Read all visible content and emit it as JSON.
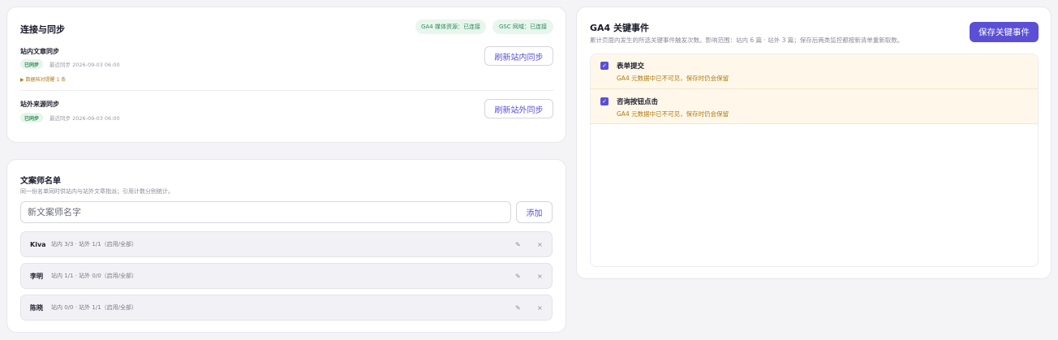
{
  "sync": {
    "title": "连接与同步",
    "ga4_status": "GA4 媒体资源：已连接",
    "gsc_status": "GSC 网域：已连接",
    "internal": {
      "label": "站内文章同步",
      "badge": "已同步",
      "last_sync": "最近同步 2026-09-03 06:00",
      "warning": "▶ 数据核对提醒 1 条",
      "button": "刷新站内同步"
    },
    "external": {
      "label": "站外来源同步",
      "badge": "已同步",
      "last_sync": "最近同步 2026-09-03 06:00",
      "button": "刷新站外同步"
    }
  },
  "writers": {
    "title": "文案师名单",
    "subtitle": "同一份名单同时供站内与站外文章指派；引用计数分别统计。",
    "input_placeholder": "新文案师名字",
    "add_label": "添加",
    "items": [
      {
        "name": "Kiva",
        "stats": "站内 3/3 · 站外 1/1（启用/全部）"
      },
      {
        "name": "李明",
        "stats": "站内 1/1 · 站外 0/0（启用/全部）"
      },
      {
        "name": "陈晓",
        "stats": "站内 0/0 · 站外 1/1（启用/全部）"
      }
    ],
    "edit_glyph": "✎",
    "delete_glyph": "×"
  },
  "ga4": {
    "title": "GA4 关键事件",
    "subtitle": "累计页面内发生的所选关键事件触发次数。影响范围：站内 6 篇 · 站外 3 篇；保存后两类监控都按新清单重新取数。",
    "save_label": "保存关键事件",
    "events": [
      {
        "name": "表单提交",
        "note": "GA4 元数据中已不可见，保存时仍会保留",
        "checked": true
      },
      {
        "name": "咨询按钮点击",
        "note": "GA4 元数据中已不可见，保存时仍会保留",
        "checked": true
      }
    ],
    "check_glyph": "✓"
  },
  "colors": {
    "accent": "#5b4fd6",
    "success_bg": "#e8f6ee",
    "success_text": "#2d8a55",
    "warning_text": "#b07a10",
    "event_row_bg": "#fff8ea"
  }
}
